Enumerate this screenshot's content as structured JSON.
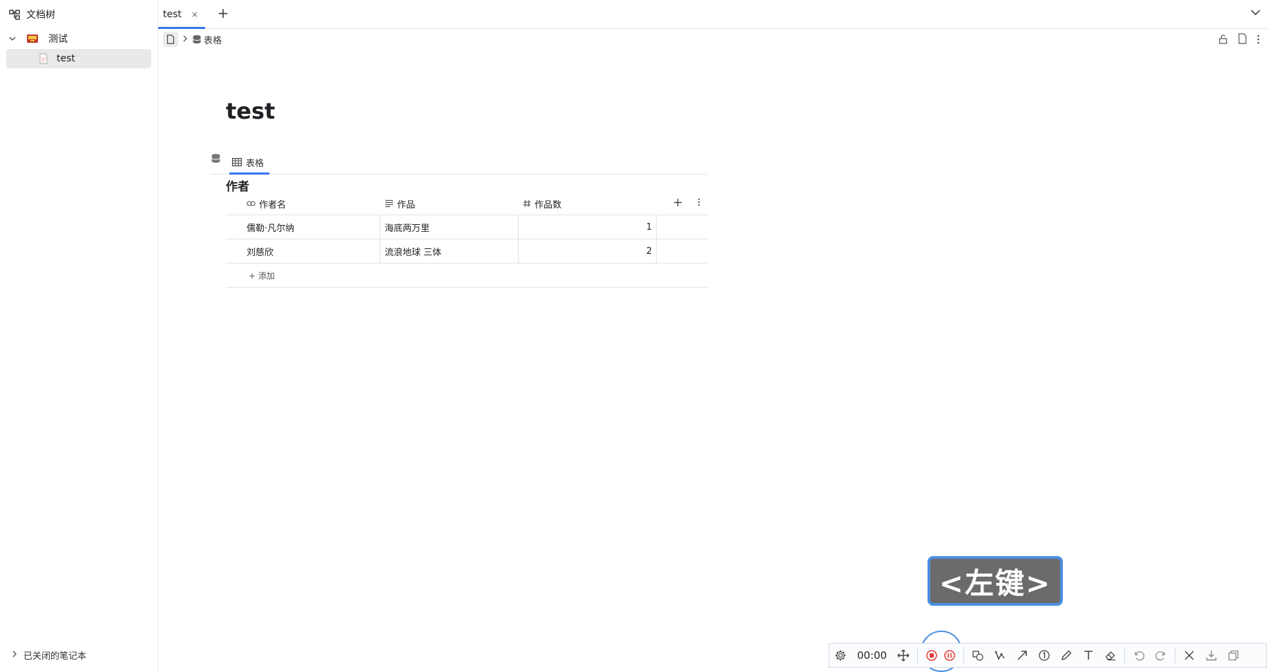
{
  "sidebar": {
    "header": {
      "label": "文档树",
      "icon": "doc-tree-icon"
    },
    "notebook": {
      "label": "测试",
      "icon": "notebook-icon",
      "expanded": true
    },
    "document": {
      "label": "test",
      "icon": "file-icon"
    },
    "closed_notebooks": {
      "label": "已关闭的笔记本"
    }
  },
  "tabs": [
    {
      "label": "test",
      "close": "×",
      "active": true
    }
  ],
  "tab_add_label": "+",
  "breadcrumb": {
    "items": [
      {
        "icon": "database-icon",
        "label": "表格"
      }
    ]
  },
  "document": {
    "title": "test"
  },
  "database": {
    "view_tab": {
      "icon": "table-icon",
      "label": "表格"
    },
    "table_title": "作者",
    "columns": [
      {
        "icon": "link-icon",
        "label": "作者名"
      },
      {
        "icon": "text-icon",
        "label": "作品"
      },
      {
        "icon": "number-icon",
        "label": "作品数"
      }
    ],
    "rows": [
      {
        "name": "儒勒·凡尔纳",
        "works": "海底两万里",
        "count": "1"
      },
      {
        "name": "刘慈欣",
        "works": "流浪地球 三体",
        "count": "2"
      }
    ],
    "add_row_label": "+ 添加"
  },
  "key_hint": "<左键>",
  "recorder": {
    "time": "00:00"
  },
  "colors": {
    "accent": "#3575f0",
    "hint_bg": "#6b6b6b",
    "hint_border": "#4a90e2",
    "record_red": "#e53935"
  }
}
